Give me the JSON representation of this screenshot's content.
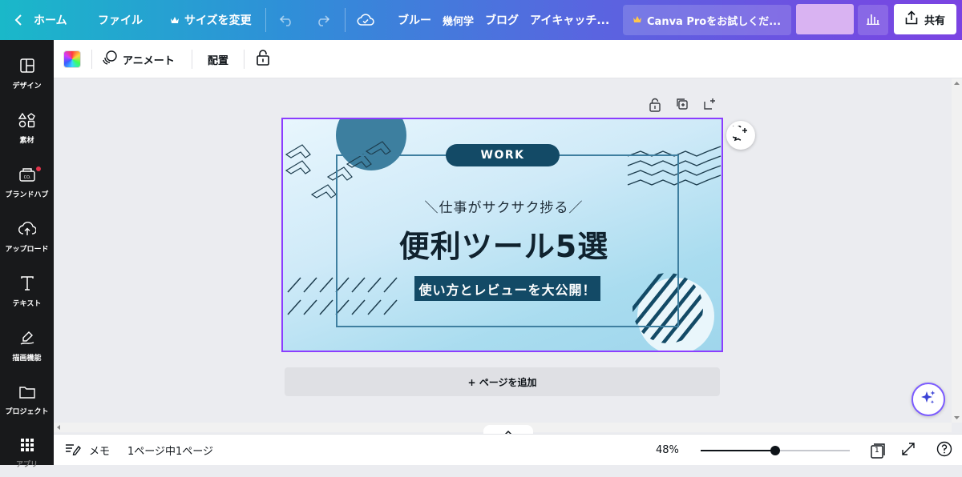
{
  "topbar": {
    "home": "ホーム",
    "file": "ファイル",
    "resize": "サイズを変更",
    "title_words": [
      "ブルー",
      "幾何学",
      "ブログ",
      "アイキャッチ..."
    ],
    "pro_trial": "Canva Proをお試しくだ...",
    "share": "共有"
  },
  "sidebar": {
    "items": [
      {
        "label": "デザイン",
        "icon": "layout-icon"
      },
      {
        "label": "素材",
        "icon": "shapes-icon"
      },
      {
        "label": "ブランドハブ",
        "icon": "brand-icon"
      },
      {
        "label": "アップロード",
        "icon": "upload-icon"
      },
      {
        "label": "テキスト",
        "icon": "text-icon"
      },
      {
        "label": "描画機能",
        "icon": "draw-icon"
      },
      {
        "label": "プロジェクト",
        "icon": "folder-icon"
      },
      {
        "label": "アプリ",
        "icon": "apps-icon"
      }
    ]
  },
  "toolbar2": {
    "animate": "アニメート",
    "arrange": "配置"
  },
  "design": {
    "badge": "WORK",
    "subtitle": "＼仕事がサクサク捗る／",
    "title": "便利ツール5選",
    "tagline": "使い方とレビューを大公開！"
  },
  "add_page": "+ ページを追加",
  "bottombar": {
    "notes": "メモ",
    "page_count": "1ページ中1ページ",
    "zoom": "48%",
    "zoom_value": 0.48,
    "page_number": "1"
  },
  "colors": {
    "accent": "#8b3dff",
    "navy": "#134a66"
  }
}
